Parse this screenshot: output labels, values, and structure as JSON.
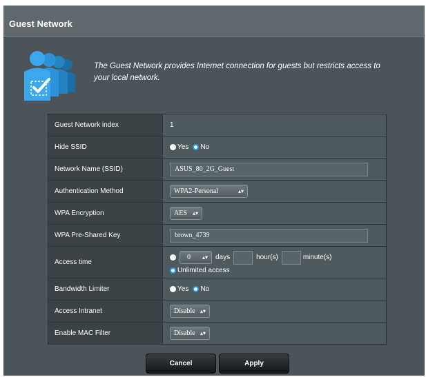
{
  "window": {
    "title": "Guest Network"
  },
  "intro": {
    "text": "The Guest Network provides Internet connection for guests but restricts access to your local network.",
    "icon": "guest-users-checkmark-icon"
  },
  "settings": {
    "index": {
      "label": "Guest Network index",
      "value": "1"
    },
    "hide_ssid": {
      "label": "Hide SSID",
      "yes": "Yes",
      "no": "No",
      "selected": "No"
    },
    "ssid": {
      "label": "Network Name (SSID)",
      "value": "ASUS_80_2G_Guest"
    },
    "auth": {
      "label": "Authentication Method",
      "value": "WPA2-Personal"
    },
    "encryption": {
      "label": "WPA Encryption",
      "value": "AES"
    },
    "psk": {
      "label": "WPA Pre-Shared Key",
      "value": "brown_4739"
    },
    "access_time": {
      "label": "Access time",
      "days_value": "0",
      "days_unit": "days",
      "hours_unit": "hour(s)",
      "minutes_unit": "minute(s)",
      "unlimited": "Unlimited access",
      "selected": "Unlimited access"
    },
    "bandwidth": {
      "label": "Bandwidth Limiter",
      "yes": "Yes",
      "no": "No",
      "selected": "No"
    },
    "intranet": {
      "label": "Access Intranet",
      "value": "Disable"
    },
    "mac_filter": {
      "label": "Enable MAC Filter",
      "value": "Disable"
    }
  },
  "buttons": {
    "cancel": "Cancel",
    "apply": "Apply"
  },
  "colors": {
    "accent": "#1fa0e8",
    "background": "#4a5459",
    "label_cell": "#3a4246"
  }
}
